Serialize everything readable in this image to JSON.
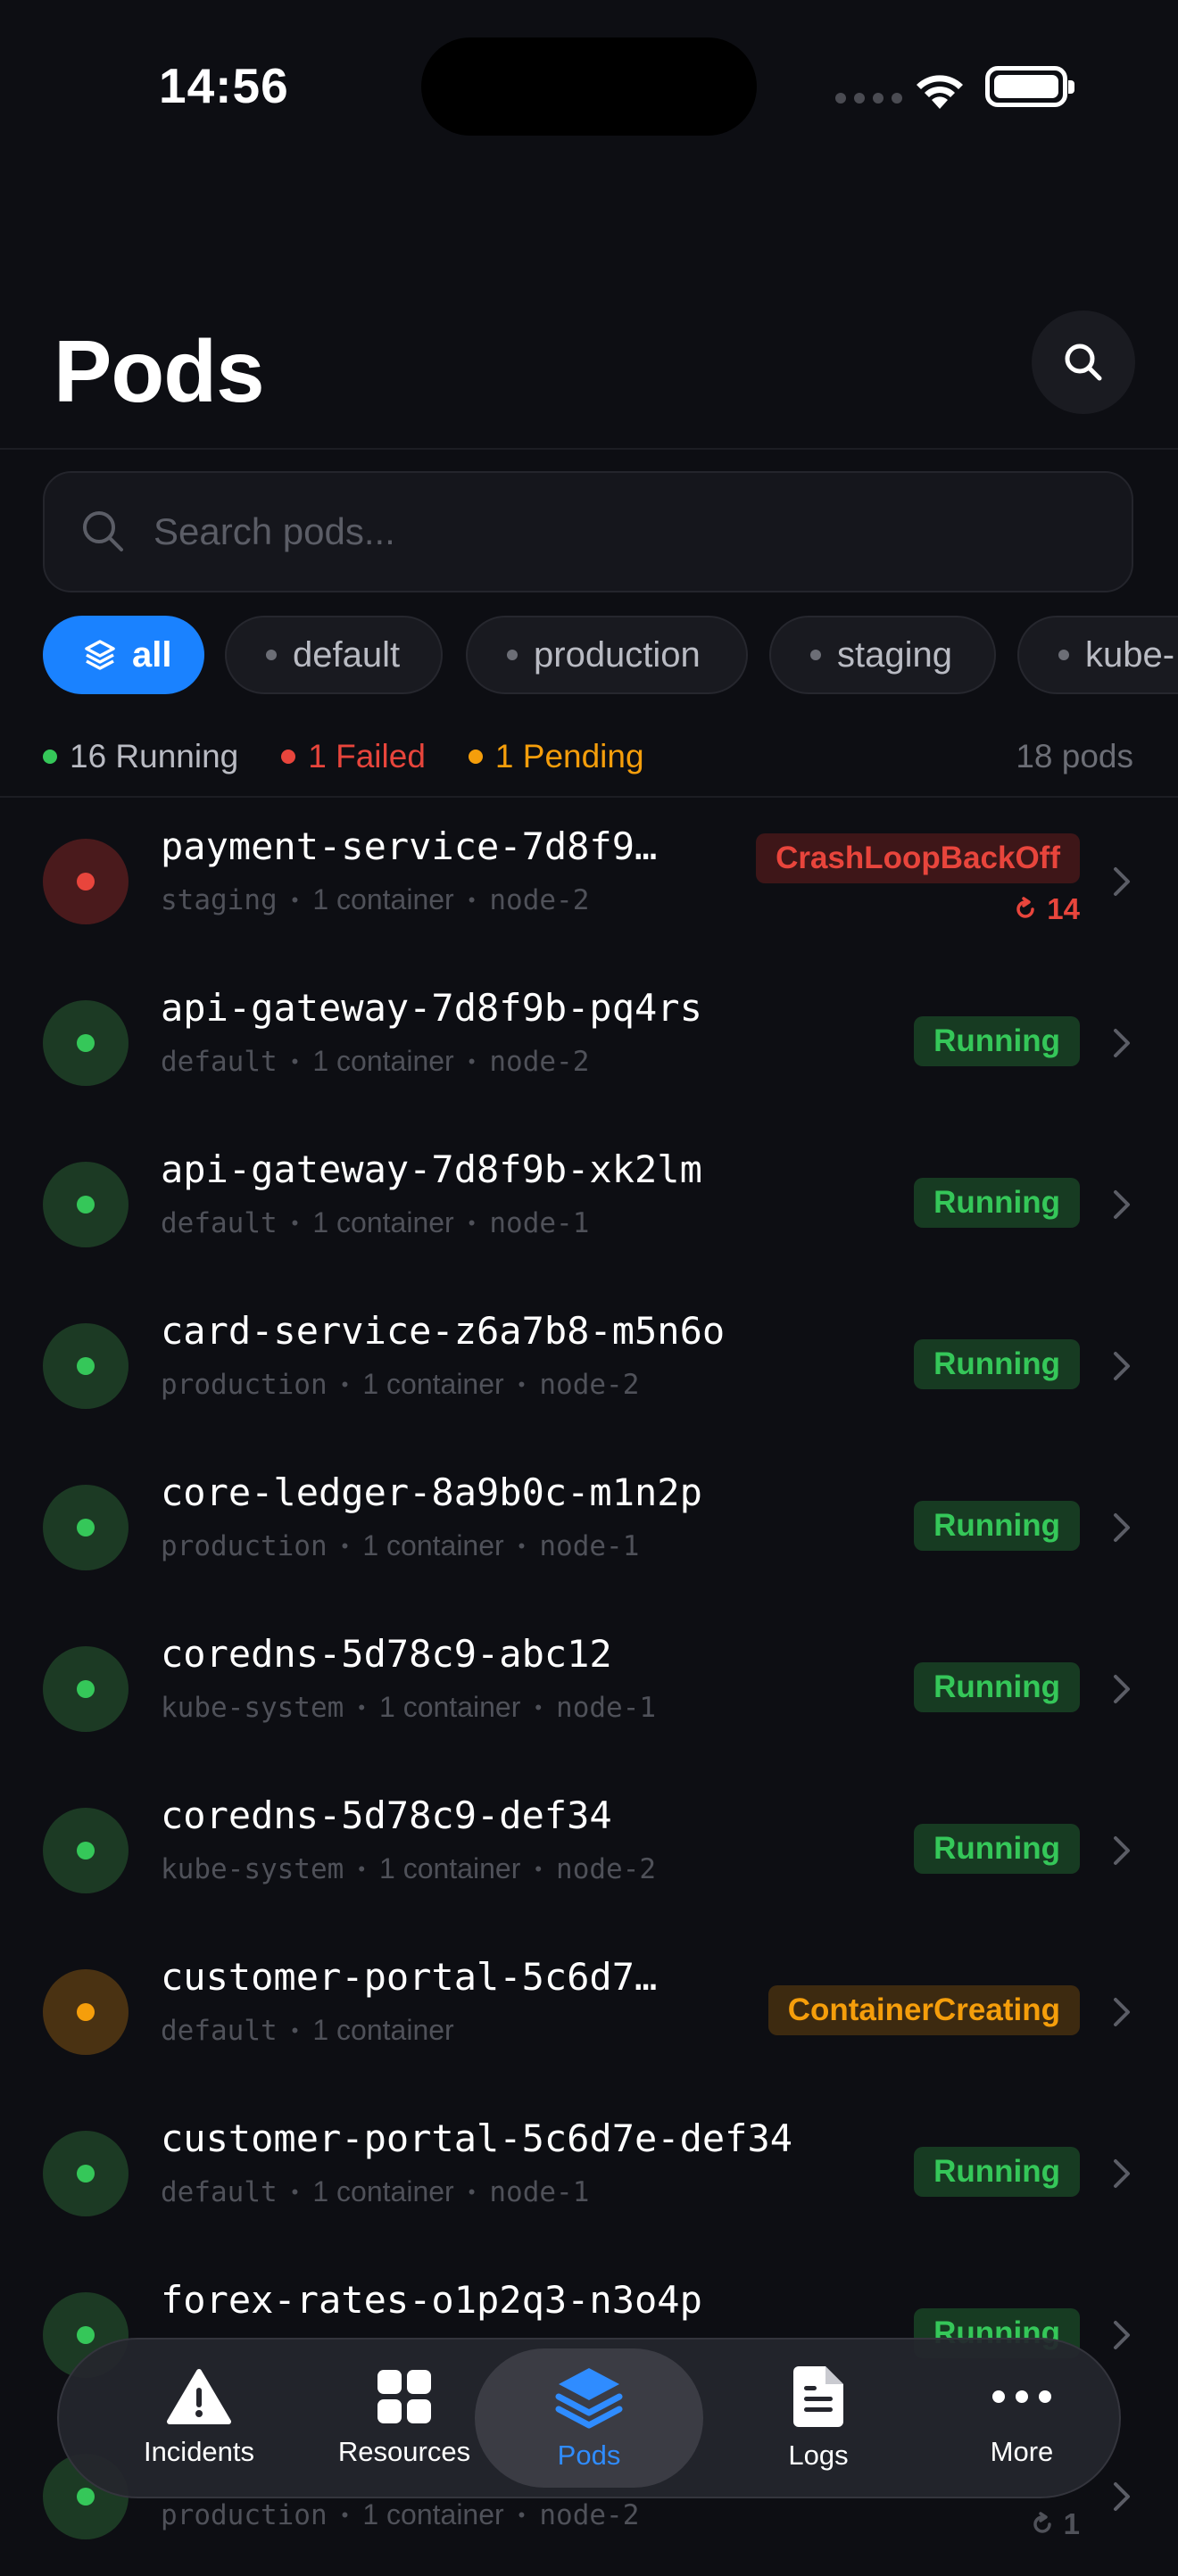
{
  "status_bar": {
    "time": "14:56"
  },
  "header": {
    "title": "Pods"
  },
  "search": {
    "placeholder": "Search pods..."
  },
  "filters": [
    {
      "label": "all",
      "active": true
    },
    {
      "label": "default",
      "active": false
    },
    {
      "label": "production",
      "active": false
    },
    {
      "label": "staging",
      "active": false
    },
    {
      "label": "kube-",
      "active": false
    }
  ],
  "summary": {
    "running": "16 Running",
    "failed": "1 Failed",
    "pending": "1 Pending",
    "total": "18 pods"
  },
  "colors": {
    "accent": "#1a82ff",
    "running": "#35c759",
    "failed": "#e8453c",
    "pending": "#f59e0b"
  },
  "pods": [
    {
      "name": "payment-service-7d8f9…",
      "namespace": "staging",
      "containers": "1 container",
      "node": "node-2",
      "status": "CrashLoopBackOff",
      "state": "failed",
      "restarts": "14"
    },
    {
      "name": "api-gateway-7d8f9b-pq4rs",
      "namespace": "default",
      "containers": "1 container",
      "node": "node-2",
      "status": "Running",
      "state": "running"
    },
    {
      "name": "api-gateway-7d8f9b-xk2lm",
      "namespace": "default",
      "containers": "1 container",
      "node": "node-1",
      "status": "Running",
      "state": "running"
    },
    {
      "name": "card-service-z6a7b8-m5n6o",
      "namespace": "production",
      "containers": "1 container",
      "node": "node-2",
      "status": "Running",
      "state": "running"
    },
    {
      "name": "core-ledger-8a9b0c-m1n2p",
      "namespace": "production",
      "containers": "1 container",
      "node": "node-1",
      "status": "Running",
      "state": "running"
    },
    {
      "name": "coredns-5d78c9-abc12",
      "namespace": "kube-system",
      "containers": "1 container",
      "node": "node-1",
      "status": "Running",
      "state": "running"
    },
    {
      "name": "coredns-5d78c9-def34",
      "namespace": "kube-system",
      "containers": "1 container",
      "node": "node-2",
      "status": "Running",
      "state": "running"
    },
    {
      "name": "customer-portal-5c6d7…",
      "namespace": "default",
      "containers": "1 container",
      "node": "",
      "status": "ContainerCreating",
      "state": "pending"
    },
    {
      "name": "customer-portal-5c6d7e-def34",
      "namespace": "default",
      "containers": "1 container",
      "node": "node-1",
      "status": "Running",
      "state": "running"
    },
    {
      "name": "forex-rates-o1p2q3-n3o4p",
      "namespace": "",
      "containers": "",
      "node": "",
      "status": "Running",
      "state": "running"
    },
    {
      "name": "",
      "namespace": "production",
      "containers": "1 container",
      "node": "node-2",
      "status": "",
      "state": "running",
      "restarts": "1"
    }
  ],
  "tabbar": {
    "items": [
      {
        "label": "Incidents",
        "icon": "warning-icon"
      },
      {
        "label": "Resources",
        "icon": "grid-icon"
      },
      {
        "label": "Pods",
        "icon": "layers-icon",
        "active": true
      },
      {
        "label": "Logs",
        "icon": "document-icon"
      },
      {
        "label": "More",
        "icon": "more-icon"
      }
    ]
  }
}
